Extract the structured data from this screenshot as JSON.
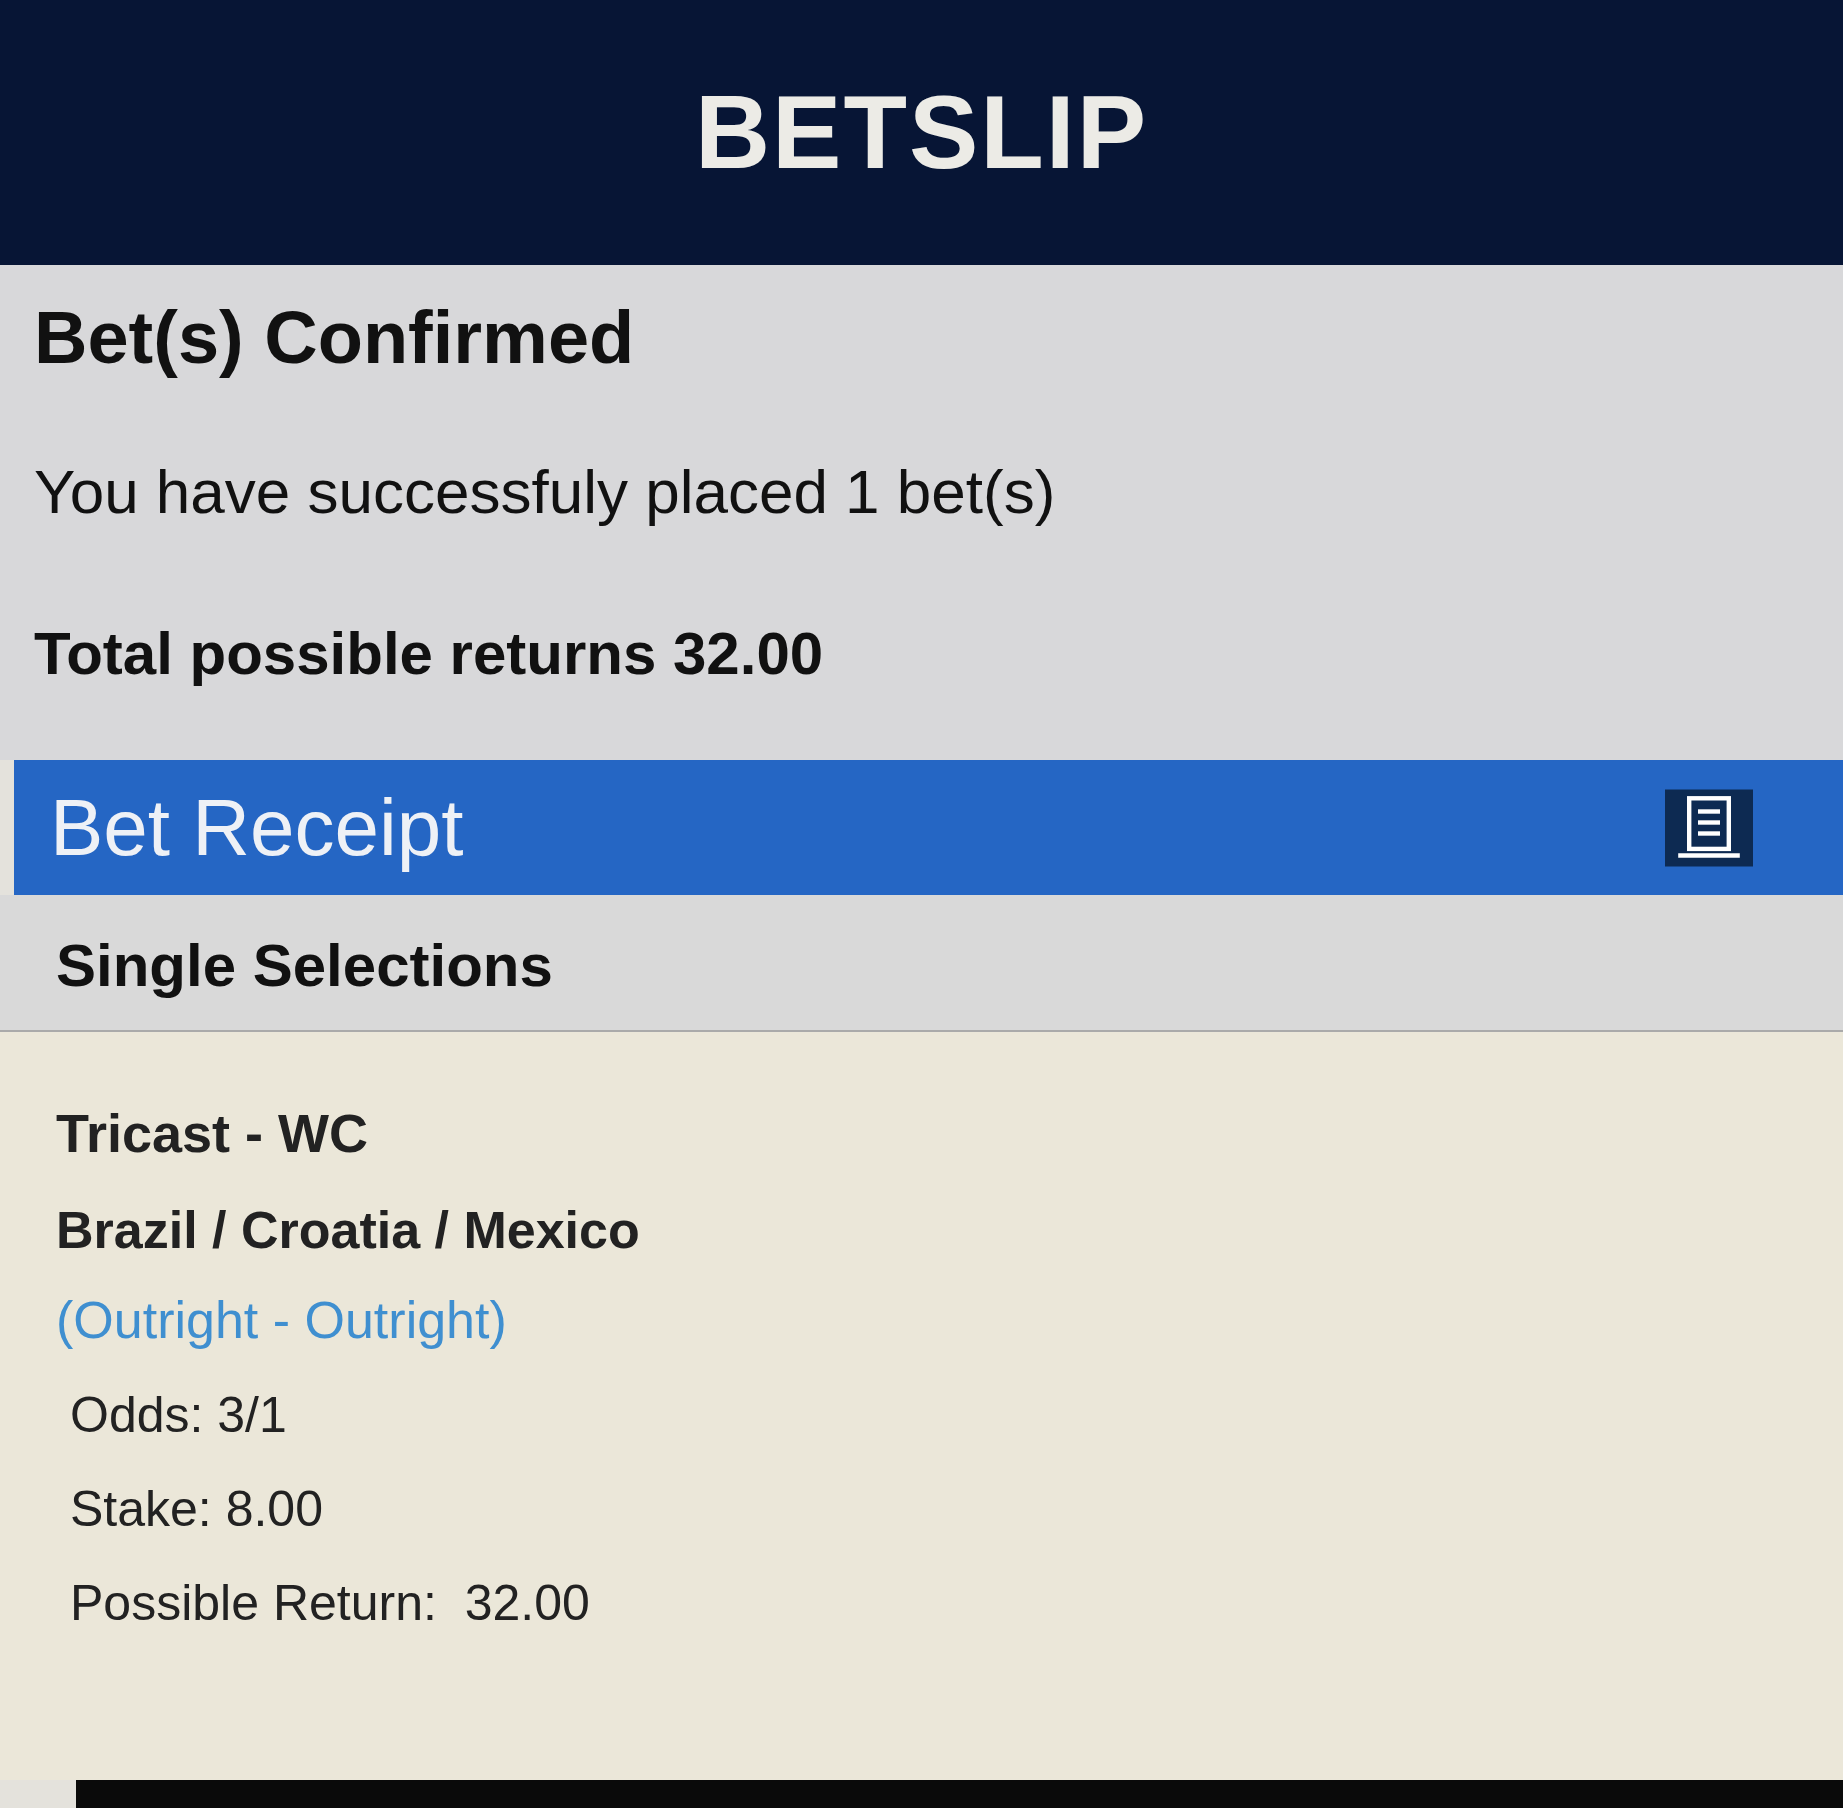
{
  "header": {
    "title": "BETSLIP"
  },
  "confirmation": {
    "heading": "Bet(s) Confirmed",
    "message": "You have successfuly placed 1 bet(s)",
    "total": "Total possible returns 32.00"
  },
  "receipt": {
    "title": "Bet Receipt",
    "section": "Single Selections",
    "bets": [
      {
        "market": "Tricast - WC",
        "selection": "Brazil / Croatia / Mexico",
        "event": "(Outright - Outright)",
        "odds": "Odds: 3/1",
        "stake": "Stake: 8.00",
        "possible_return": "Possible Return:  32.00"
      }
    ]
  }
}
